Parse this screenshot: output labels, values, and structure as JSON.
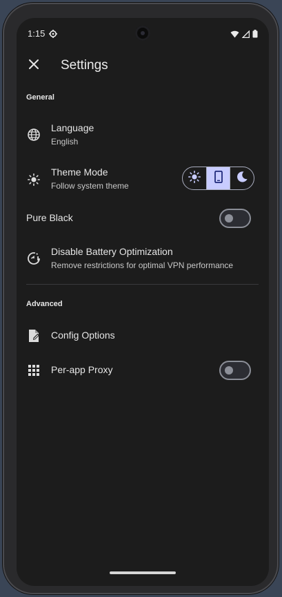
{
  "status": {
    "time": "1:15"
  },
  "appbar": {
    "title": "Settings"
  },
  "sections": {
    "general": "General",
    "advanced": "Advanced"
  },
  "settings": {
    "language": {
      "title": "Language",
      "subtitle": "English"
    },
    "theme": {
      "title": "Theme Mode",
      "subtitle": "Follow system theme",
      "options": [
        "light",
        "system",
        "dark"
      ],
      "selected": "system"
    },
    "pure_black": {
      "title": "Pure Black",
      "enabled": false
    },
    "battery": {
      "title": "Disable Battery Optimization",
      "subtitle": "Remove restrictions for optimal VPN performance"
    },
    "config": {
      "title": "Config Options"
    },
    "per_app": {
      "title": "Per-app Proxy",
      "enabled": false
    }
  },
  "colors": {
    "accent": "#c8ccff",
    "background": "#1c1c1c"
  }
}
